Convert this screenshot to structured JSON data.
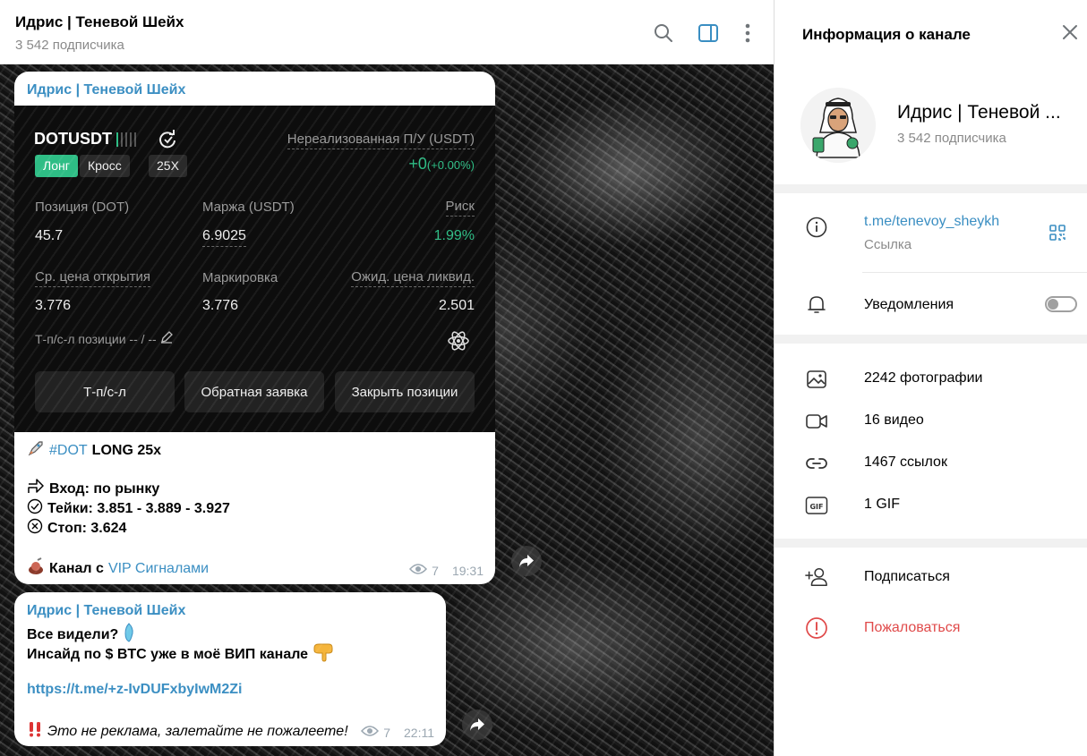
{
  "chat": {
    "title": "Идрис | Теневой Шейх",
    "subscribers": "3 542 подписчика"
  },
  "messages": [
    {
      "sender": "Идрис | Теневой Шейх",
      "card": {
        "symbol": "DOTUSDT",
        "tags": [
          "Лонг",
          "Кросс",
          "25X"
        ],
        "pnl_label": "Нереализованная П/У (USDT)",
        "pnl_value": "+0",
        "pnl_pct": "(+0.00%)",
        "position_label": "Позиция (DOT)",
        "position_value": "45.7",
        "margin_label": "Маржа (USDT)",
        "margin_value": "6.9025",
        "risk_label": "Риск",
        "risk_value": "1.99%",
        "entry_label": "Ср. цена открытия",
        "entry_value": "3.776",
        "mark_label": "Маркировка",
        "mark_value": "3.776",
        "liq_label": "Ожид. цена ликвид.",
        "liq_value": "2.501",
        "tpsl_label": "Т-п/с-л позиции -- / --",
        "buttons": [
          "Т-п/с-л",
          "Обратная заявка",
          "Закрыть позиции"
        ]
      },
      "hashtag": "#DOT",
      "signal": "LONG 25x",
      "entry": "Вход: по рынку",
      "takes": "Тейки: 3.851 - 3.889 - 3.927",
      "stop": "Стоп: 3.624",
      "footer_prefix": "Канал с",
      "footer_link": "VIP Сигналами",
      "views": "7",
      "time": "19:31"
    },
    {
      "sender": "Идрис | Теневой Шейх",
      "line1": "Все видели?",
      "line2": "Инсайд по $ BTC уже в моё ВИП канале",
      "link": "https://t.me/+z-IvDUFxbyIwM2Zi",
      "note": "Это не реклама, залетайте не пожалеете!",
      "views": "7",
      "time": "22:11"
    }
  ],
  "panel": {
    "title": "Информация о канале",
    "name": "Идрис | Теневой ...",
    "subscribers": "3 542 подписчика",
    "link": "t.me/tenevoy_sheykh",
    "link_caption": "Ссылка",
    "notifications": "Уведомления",
    "notifications_on": false,
    "media": {
      "photos": "2242 фотографии",
      "videos": "16 видео",
      "links": "1467 ссылок",
      "gifs": "1 GIF"
    },
    "subscribe": "Подписаться",
    "report": "Пожаловаться"
  },
  "colors": {
    "accent": "#3a8ec2",
    "long_green": "#2ebd85",
    "report_red": "#e04a4a"
  },
  "icons": [
    "search-icon",
    "sidebar-toggle-icon",
    "more-icon",
    "close-icon",
    "info-icon",
    "qr-icon",
    "bell-icon",
    "image-icon",
    "video-icon",
    "link-icon",
    "gif-icon",
    "add-user-icon",
    "warning-icon",
    "eye-icon",
    "share-icon",
    "rocket-icon",
    "refresh-icon",
    "edit-icon",
    "atom-icon"
  ]
}
